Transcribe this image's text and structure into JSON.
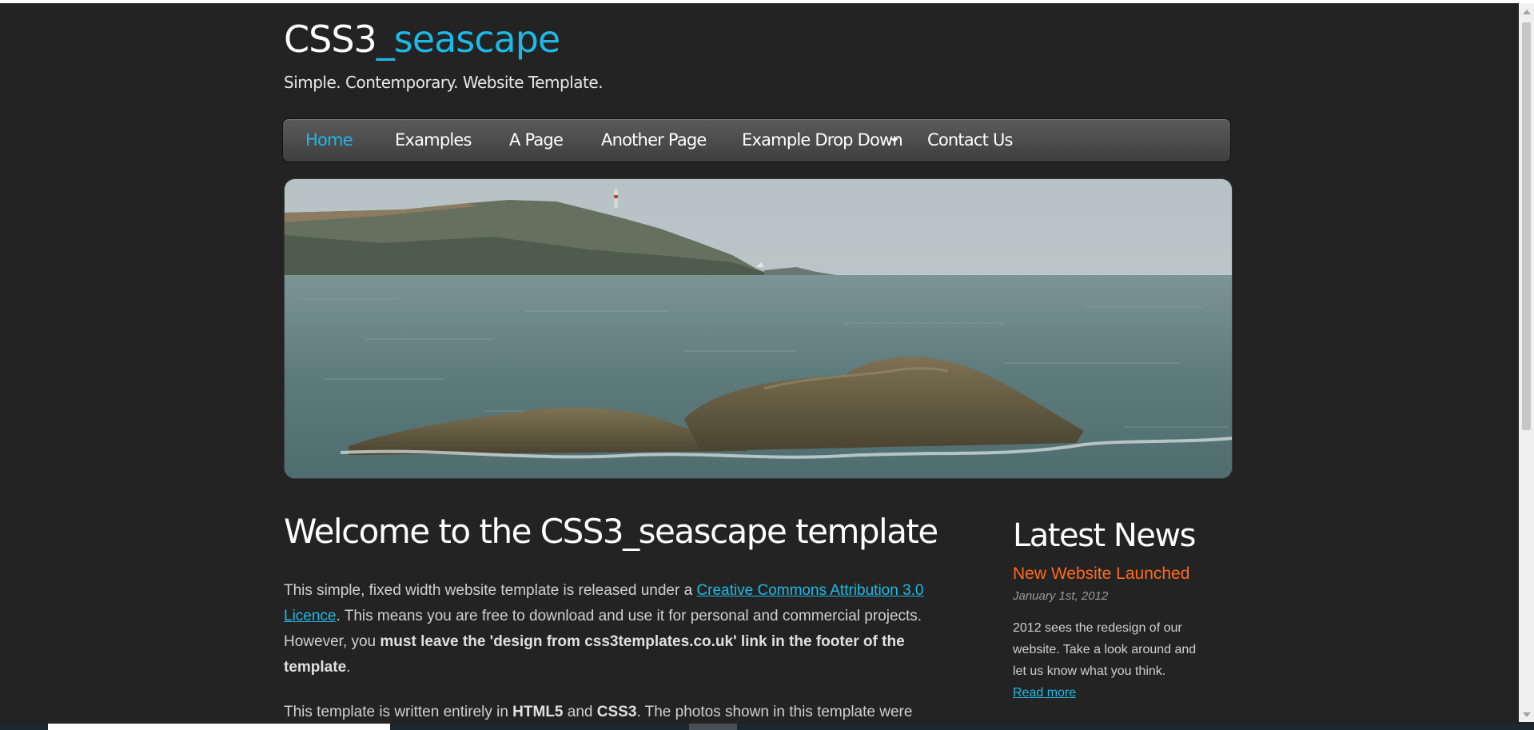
{
  "header": {
    "logo_main": "CSS3",
    "logo_accent": "_seascape",
    "slogan": "Simple. Contemporary. Website Template."
  },
  "nav": {
    "items": [
      {
        "label": "Home",
        "active": true
      },
      {
        "label": "Examples"
      },
      {
        "label": "A Page"
      },
      {
        "label": "Another Page"
      },
      {
        "label": "Example Drop Down",
        "has_dropdown": true
      },
      {
        "label": "Contact Us"
      }
    ]
  },
  "content": {
    "title": "Welcome to the CSS3_seascape template",
    "p1_text_a": "This simple, fixed width website template is released under a ",
    "p1_link": "Creative Commons Attribution 3.0 Licence",
    "p1_text_b": ". This means you are free to download and use it for personal and commercial projects. However, you ",
    "p1_bold": "must leave the 'design from css3templates.co.uk' link in the footer of the template",
    "p1_text_c": ".",
    "p2_text_a": "This template is written entirely in ",
    "p2_bold1": "HTML5",
    "p2_text_b": " and ",
    "p2_bold2": "CSS3",
    "p2_text_c": ". The photos shown in this template were"
  },
  "sidebar": {
    "title": "Latest News",
    "news_title": "New Website Launched",
    "news_date": "January 1st, 2012",
    "news_body": "2012 sees the redesign of our website. Take a look around and let us know what you think.",
    "read_more": "Read more"
  },
  "colors": {
    "background": "#232323",
    "accent": "#1eb8e6",
    "news_heading": "#ff6a1a"
  }
}
